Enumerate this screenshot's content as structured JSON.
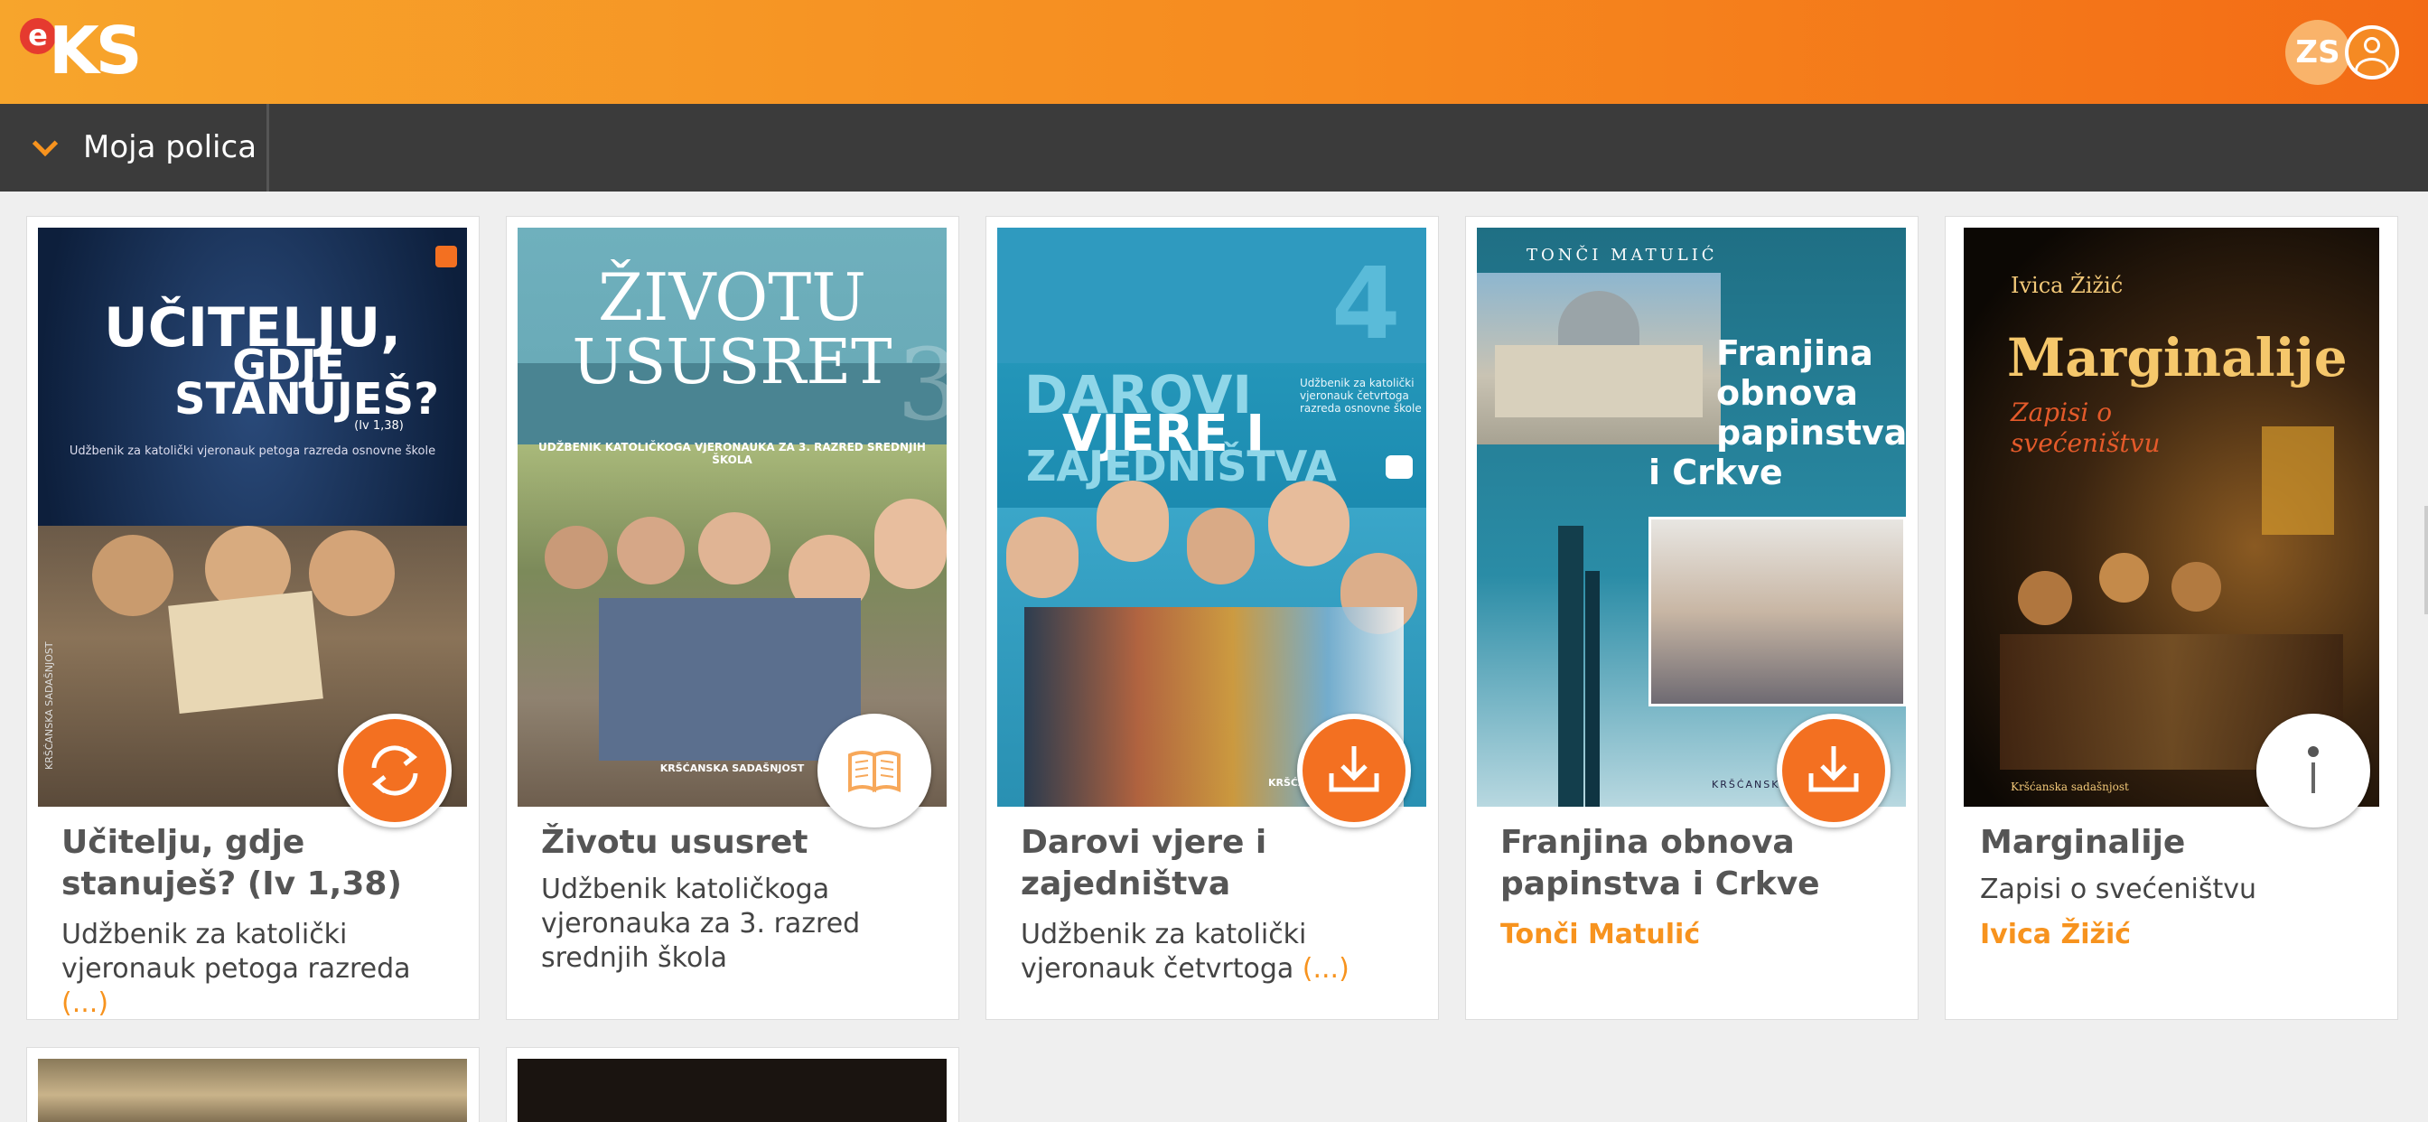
{
  "header": {
    "logo_e": "e",
    "logo_ks": "KS",
    "user_initials": "ZS"
  },
  "nav": {
    "shelf_label": "Moja polica"
  },
  "books": [
    {
      "title": "Učitelju, gdje stanuješ? (Iv 1,38)",
      "description": "Udžbenik za katolički vjeronauk petoga razreda ",
      "ellipsis": "(...)",
      "author": "",
      "action": "sync-icon",
      "cover": {
        "title_line1": "UČITELJU,",
        "title_line2": "GDJE",
        "title_line3": "STANUJEŠ?",
        "ref": "(Iv 1,38)",
        "subtitle": "Udžbenik za katolički vjeronauk petoga razreda osnovne škole",
        "side": "KRŠĆANSKA SADAŠNJOST"
      }
    },
    {
      "title": "Životu ususret",
      "description": "Udžbenik katoličkoga vjeronauka za 3. razred srednjih škola",
      "ellipsis": "",
      "author": "",
      "action": "book-open-icon",
      "cover": {
        "title_line1": "ŽIVOTU",
        "title_line2": "USUSRET",
        "number": "3",
        "subtitle": "UDŽBENIK KATOLIČKOGA VJERONAUKA ZA 3. RAZRED SREDNJIH ŠKOLA",
        "publisher": "KRŠĆANSKA SADAŠNJOST"
      }
    },
    {
      "title": "Darovi vjere i zajedništva",
      "description": "Udžbenik za katolički vjeronauk četvrtoga ",
      "ellipsis": "(...)",
      "author": "",
      "action": "download-icon",
      "cover": {
        "title_line1": "DAROVI",
        "title_line2": "VJERE I",
        "title_line3": "ZAJEDNIŠTVA",
        "number": "4",
        "subtitle": "Udžbenik za katolički vjeronauk četvrtoga razreda osnovne škole",
        "publisher": "KRŠĆAN"
      }
    },
    {
      "title": "Franjina obnova papinstva i Crkve",
      "description": "",
      "ellipsis": "",
      "author": "Tonči Matulić",
      "action": "download-icon",
      "cover": {
        "author": "TONČI MATULIĆ",
        "title_line1": "Franjina",
        "title_line2": "obnova",
        "title_line3": "papinstva",
        "title_line4": "i Crkve",
        "publisher": "KRŠĆANSKA SA"
      }
    },
    {
      "title": "Marginalije",
      "description": "Zapisi o svećeništvu",
      "ellipsis": "",
      "author": "Ivica Žižić",
      "action": "info-icon",
      "cover": {
        "author": "Ivica Žižić",
        "title_line1": "Marginalije",
        "subtitle_line1": "Zapisi o",
        "subtitle_line2": "svećeništvu",
        "publisher": "Kršćanska sadašnjost"
      }
    }
  ],
  "colors": {
    "accent": "#f7931e",
    "action_orange": "#f37021",
    "subbar": "#3b3b3b"
  }
}
